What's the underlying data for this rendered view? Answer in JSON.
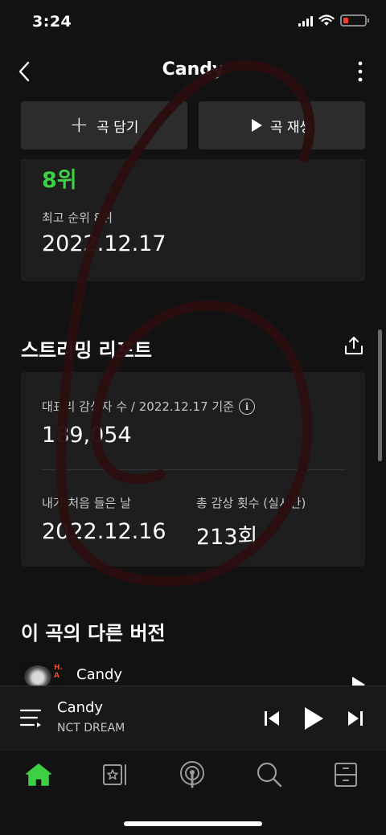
{
  "status_bar": {
    "time": "3:24"
  },
  "header": {
    "title": "Candy"
  },
  "actions": {
    "add_label": "곡 담기",
    "play_label": "곡 재생"
  },
  "chart": {
    "current_rank": "8위",
    "peak_label": "최고 순위 8위",
    "peak_date": "2022.12.17"
  },
  "stream_report": {
    "title": "스트리밍 리포트",
    "listener_label": "대표리 감상자 수 / 2022.12.17 기준",
    "listener_count": "189,054",
    "first_listen_label": "내가 처음 들은 날",
    "first_listen_date": "2022.12.16",
    "total_plays_label": "총 감상 횟수 (실시간)",
    "total_plays_value": "213회"
  },
  "other_versions": {
    "title": "이 곡의 다른 버전",
    "items": [
      {
        "name": "Candy",
        "thumb_text": "H.\nA"
      }
    ]
  },
  "now_playing": {
    "title": "Candy",
    "artist": "NCT DREAM"
  },
  "nav": {
    "items": [
      {
        "icon": "home-icon",
        "active": true
      },
      {
        "icon": "library-icon"
      },
      {
        "icon": "podcast-icon"
      },
      {
        "icon": "search-icon"
      },
      {
        "icon": "storage-icon"
      }
    ]
  },
  "colors": {
    "accent": "#3ed146",
    "background": "#121212",
    "card": "#1e1e1e",
    "scribble": "#2b0e10"
  }
}
